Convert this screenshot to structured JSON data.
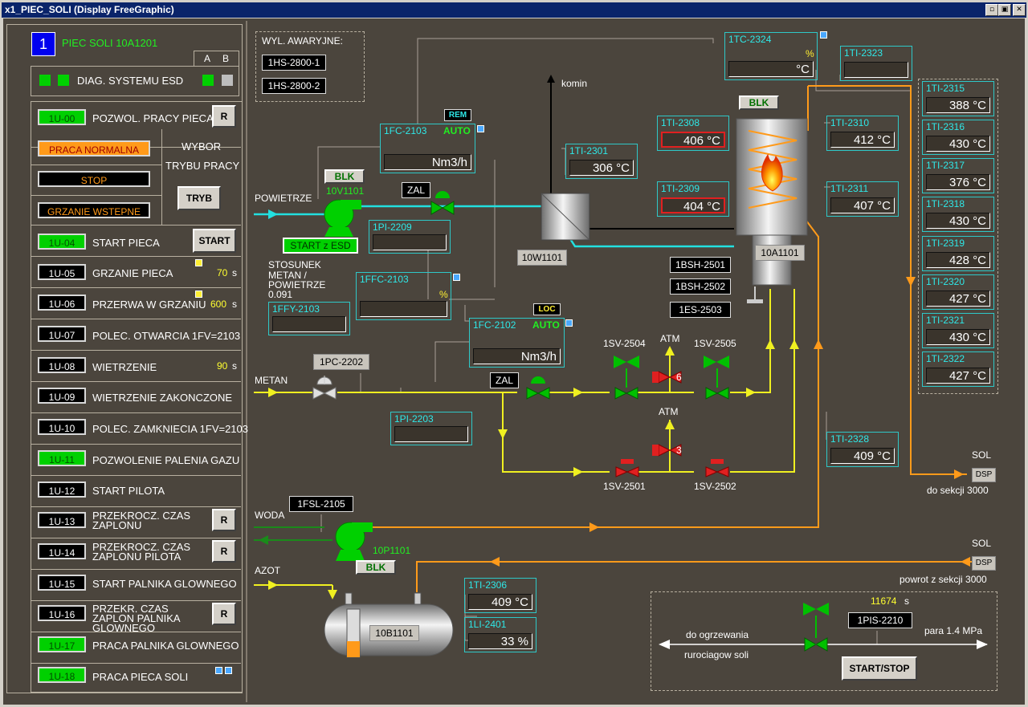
{
  "window": {
    "title": "x1_PIEC_SOLI (Display FreeGraphic)"
  },
  "left": {
    "unit_number": "1",
    "unit_name": "PIEC SOLI 10A1201",
    "col_a": "A",
    "col_b": "B",
    "diag_label": "DIAG. SYSTEMU ESD",
    "rows": [
      {
        "tag": "1U-00",
        "label": "POZWOL. PRACY PIECA",
        "state": "on"
      },
      {
        "tag": "1U-04",
        "label": "START PIECA",
        "state": "on"
      },
      {
        "tag": "1U-05",
        "label": "GRZANIE PIECA",
        "value": "70",
        "unit": "s"
      },
      {
        "tag": "1U-06",
        "label": "PRZERWA W GRZANIU",
        "value": "600",
        "unit": "s"
      },
      {
        "tag": "1U-07",
        "label": "POLEC. OTWARCIA 1FV=2103"
      },
      {
        "tag": "1U-08",
        "label": "WIETRZENIE",
        "value": "90",
        "unit": "s"
      },
      {
        "tag": "1U-09",
        "label": "WIETRZENIE ZAKONCZONE"
      },
      {
        "tag": "1U-10",
        "label": "POLEC. ZAMKNIECIA 1FV=2103"
      },
      {
        "tag": "1U-11",
        "label": "POZWOLENIE PALENIA GAZU",
        "state": "on"
      },
      {
        "tag": "1U-12",
        "label": "START PILOTA"
      },
      {
        "tag": "1U-13",
        "label": "PRZEKROCZ. CZAS ZAPLONU"
      },
      {
        "tag": "1U-14",
        "label": "PRZEKROCZ. CZAS ZAPLONU PILOTA"
      },
      {
        "tag": "1U-15",
        "label": "START PALNIKA GLOWNEGO"
      },
      {
        "tag": "1U-16",
        "label": "PRZEKR. CZAS ZAPLON PALNIKA GLOWNEGO"
      },
      {
        "tag": "1U-17",
        "label": "PRACA PALNIKA GLOWNEGO",
        "state": "on"
      },
      {
        "tag": "1U-18",
        "label": "PRACA PIECA SOLI",
        "state": "on"
      }
    ],
    "mode": {
      "normal": "PRACA NORMALNA",
      "stop": "STOP",
      "preheat": "GRZANIE WSTEPNE",
      "select_label_1": "WYBOR",
      "select_label_2": "TRYBU PRACY",
      "tryb_button": "TRYB"
    },
    "btn_r": "R",
    "btn_start": "START"
  },
  "process": {
    "emergency": {
      "title": "WYL. AWARYJNE:",
      "b1": "1HS-2800-1",
      "b2": "1HS-2800-2"
    },
    "labels": {
      "komin": "komin",
      "powietrze": "POWIETRZE",
      "metan": "METAN",
      "woda": "WODA",
      "azot": "AZOT",
      "atm1": "ATM",
      "atm2": "ATM",
      "sol1": "SOL",
      "sol2": "SOL",
      "do_sekcji": "do sekcji 3000",
      "powrot": "powrot z sekcji 3000",
      "ratio_1": "STOSUNEK",
      "ratio_2": "METAN /",
      "ratio_3": "POWIETRZE",
      "ratio_val": "0.091",
      "v6": "6",
      "v3": "3",
      "dsp1": "DSP",
      "dsp2": "DSP"
    },
    "equipment": {
      "fan1": "10V1101",
      "hx": "10W1101",
      "furnace": "10A1101",
      "pump": "10P1101",
      "tank": "10B1101",
      "sv2504": "1SV-2504",
      "sv2505": "1SV-2505",
      "sv2501": "1SV-2501",
      "sv2502": "1SV-2502",
      "pc2202": "1PC-2202",
      "fsl2105": "1FSL-2105",
      "bsh2501": "1BSH-2501",
      "bsh2502": "1BSH-2502",
      "es2503": "1ES-2503"
    },
    "buttons": {
      "blk": "BLK",
      "zal": "ZAL",
      "start_esd": "START z ESD",
      "rem": "REM",
      "loc": "LOC",
      "start_stop": "START/STOP"
    },
    "fc2103": {
      "name": "1FC-2103",
      "mode": "AUTO",
      "unit": "Nm3/h"
    },
    "fc2102": {
      "name": "1FC-2102",
      "mode": "AUTO",
      "unit": "Nm3/h"
    },
    "ffc2103": {
      "name": "1FFC-2103",
      "unit": "%"
    },
    "ffy2103": {
      "name": "1FFY-2103"
    },
    "pi2209": {
      "name": "1PI-2209"
    },
    "pi2203": {
      "name": "1PI-2203"
    },
    "tc2324": {
      "name": "1TC-2324",
      "unit": "%",
      "value": "°C"
    },
    "ti2323": {
      "name": "1TI-2323"
    },
    "ti2301": {
      "name": "1TI-2301",
      "value": "306 °C"
    },
    "ti2308": {
      "name": "1TI-2308",
      "value": "406 °C"
    },
    "ti2309": {
      "name": "1TI-2309",
      "value": "404 °C"
    },
    "ti2310": {
      "name": "1TI-2310",
      "value": "412 °C"
    },
    "ti2311": {
      "name": "1TI-2311",
      "value": "407 °C"
    },
    "ti2328": {
      "name": "1TI-2328",
      "value": "409 °C"
    },
    "ti2306": {
      "name": "1TI-2306",
      "value": "409 °C"
    },
    "li2401": {
      "name": "1LI-2401",
      "value": "33 %"
    },
    "right_temps": [
      {
        "name": "1TI-2315",
        "value": "388 °C"
      },
      {
        "name": "1TI-2316",
        "value": "430 °C"
      },
      {
        "name": "1TI-2317",
        "value": "376 °C"
      },
      {
        "name": "1TI-2318",
        "value": "430 °C"
      },
      {
        "name": "1TI-2319",
        "value": "428 °C"
      },
      {
        "name": "1TI-2320",
        "value": "427 °C"
      },
      {
        "name": "1TI-2321",
        "value": "430 °C"
      },
      {
        "name": "1TI-2322",
        "value": "427 °C"
      }
    ],
    "heating": {
      "timer": "11674",
      "timer_unit": "s",
      "pis": "1PIS-2210",
      "to_heating_1": "do ogrzewania",
      "to_heating_2": "rurociagow soli",
      "pressure": "para 1.4 MPa"
    }
  },
  "colors": {
    "background": "#4b453d",
    "air": "#22e0e0",
    "methane": "#f0f020",
    "salt": "#ff9a1a",
    "water": "#1a8a1a",
    "active": "#00d000"
  }
}
